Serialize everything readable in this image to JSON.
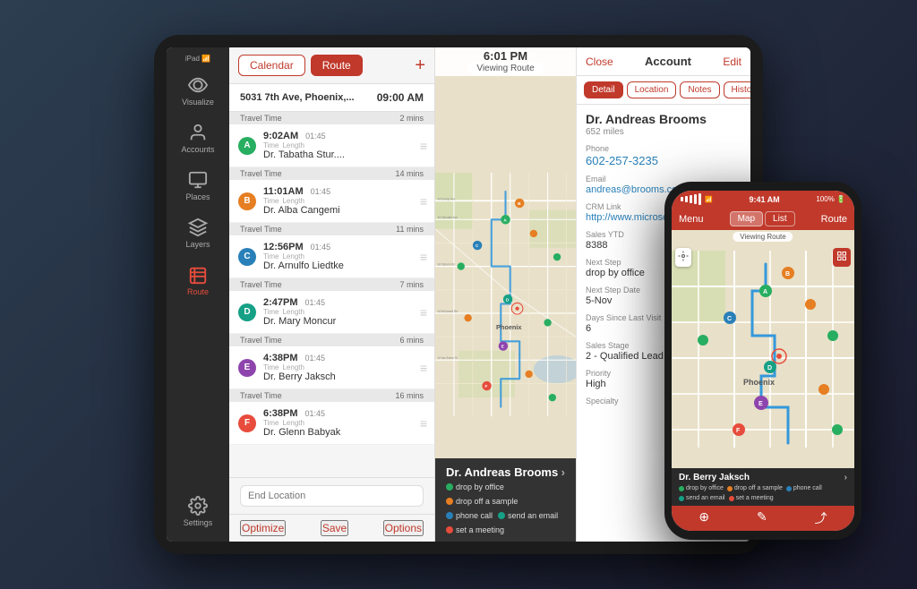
{
  "ipad": {
    "sidebar": {
      "items": [
        {
          "id": "visualize",
          "label": "Visualize",
          "icon": "eye"
        },
        {
          "id": "accounts",
          "label": "Accounts",
          "icon": "person"
        },
        {
          "id": "places",
          "label": "Places",
          "icon": "building"
        },
        {
          "id": "layers",
          "label": "Layers",
          "icon": "layers"
        },
        {
          "id": "route",
          "label": "Route",
          "icon": "route",
          "active": true
        }
      ],
      "settings_label": "Settings"
    },
    "route_panel": {
      "tab_calendar": "Calendar",
      "tab_route": "Route",
      "start_address": "5031 7th Ave, Phoenix,...",
      "start_time": "09:00 AM",
      "stops": [
        {
          "letter": "A",
          "color": "#27ae60",
          "time": "9:02AM",
          "length": "01:45",
          "name": "Dr. Tabatha Stur....",
          "travel_label": "Travel Time",
          "travel_val": "2 mins",
          "length_label": "Length"
        },
        {
          "letter": "B",
          "color": "#e67e22",
          "time": "11:01AM",
          "length": "01:45",
          "name": "Dr. Alba Cangemi",
          "travel_label": "Travel Time",
          "travel_val": "14 mins",
          "length_label": "Length"
        },
        {
          "letter": "C",
          "color": "#2980b9",
          "time": "12:56PM",
          "length": "01:45",
          "name": "Dr. Arnulfo Liedtke",
          "travel_label": "Travel Time",
          "travel_val": "11 mins",
          "length_label": "Length"
        },
        {
          "letter": "D",
          "color": "#16a085",
          "time": "2:47PM",
          "length": "01:45",
          "name": "Dr. Mary Moncur",
          "travel_label": "Travel Time",
          "travel_val": "7 mins",
          "length_label": "Length"
        },
        {
          "letter": "E",
          "color": "#8e44ad",
          "time": "4:38PM",
          "length": "01:45",
          "name": "Dr. Berry Jaksch",
          "travel_label": "Travel Time",
          "travel_val": "6 mins",
          "length_label": "Length"
        },
        {
          "letter": "F",
          "color": "#e74c3c",
          "time": "6:38PM",
          "length": "01:45",
          "name": "Dr. Glenn Babyak",
          "travel_label": "Travel Time",
          "travel_val": "16 mins",
          "length_label": "Length"
        }
      ],
      "end_location_placeholder": "End Location",
      "optimize_btn": "Optimize",
      "save_btn": "Save",
      "options_btn": "Options"
    },
    "map": {
      "time": "6:01 PM",
      "viewing_route": "Viewing Route",
      "doctor_name": "Dr. Andreas Brooms",
      "legend": [
        {
          "label": "drop by office",
          "color": "#27ae60"
        },
        {
          "label": "drop off a sample",
          "color": "#e67e22"
        },
        {
          "label": "phone call",
          "color": "#2980b9"
        },
        {
          "label": "send an email",
          "color": "#16a085"
        },
        {
          "label": "set a meeting",
          "color": "#e74c3c"
        }
      ]
    },
    "detail_panel": {
      "close_btn": "Close",
      "title": "Account",
      "edit_btn": "Edit",
      "tabs": [
        {
          "label": "Detail",
          "active": true
        },
        {
          "label": "Location"
        },
        {
          "label": "Notes"
        },
        {
          "label": "History"
        }
      ],
      "doctor_name": "Dr. Andreas Brooms",
      "miles": "652 miles",
      "fields": [
        {
          "label": "Phone",
          "value": "602-257-3235",
          "type": "phone"
        },
        {
          "label": "Email",
          "value": "andreas@brooms.com",
          "type": "link"
        },
        {
          "label": "CRM Link",
          "value": "http://www.microsoft.co",
          "type": "link"
        },
        {
          "label": "Sales YTD",
          "value": "8388",
          "type": "text"
        },
        {
          "label": "Next Step",
          "value": "drop by office",
          "type": "text"
        },
        {
          "label": "Next Step Date",
          "value": "5-Nov",
          "type": "text"
        },
        {
          "label": "Days Since Last Visit",
          "value": "6",
          "type": "text"
        },
        {
          "label": "Sales Stage",
          "value": "2 - Qualified Lead",
          "type": "text"
        },
        {
          "label": "Priority",
          "value": "High",
          "type": "text"
        },
        {
          "label": "Specialty",
          "value": "",
          "type": "text"
        }
      ]
    }
  },
  "iphone": {
    "status": {
      "signal": "●●●●●",
      "wifi": "WiFi",
      "time": "9:41 AM",
      "battery": "100%"
    },
    "nav": {
      "menu_label": "Menu",
      "tabs": [
        "Map",
        "List"
      ],
      "active_tab": "Map",
      "route_label": "Route"
    },
    "map": {
      "viewing_route": "Viewing Route"
    },
    "bottom": {
      "doctor_name": "Dr. Berry Jaksch",
      "legend": [
        {
          "label": "drop by office",
          "color": "#27ae60"
        },
        {
          "label": "drop off a sample",
          "color": "#e67e22"
        },
        {
          "label": "phone call",
          "color": "#2980b9"
        },
        {
          "label": "send an email",
          "color": "#16a085"
        },
        {
          "label": "set a meeting",
          "color": "#e74c3c"
        }
      ]
    }
  }
}
